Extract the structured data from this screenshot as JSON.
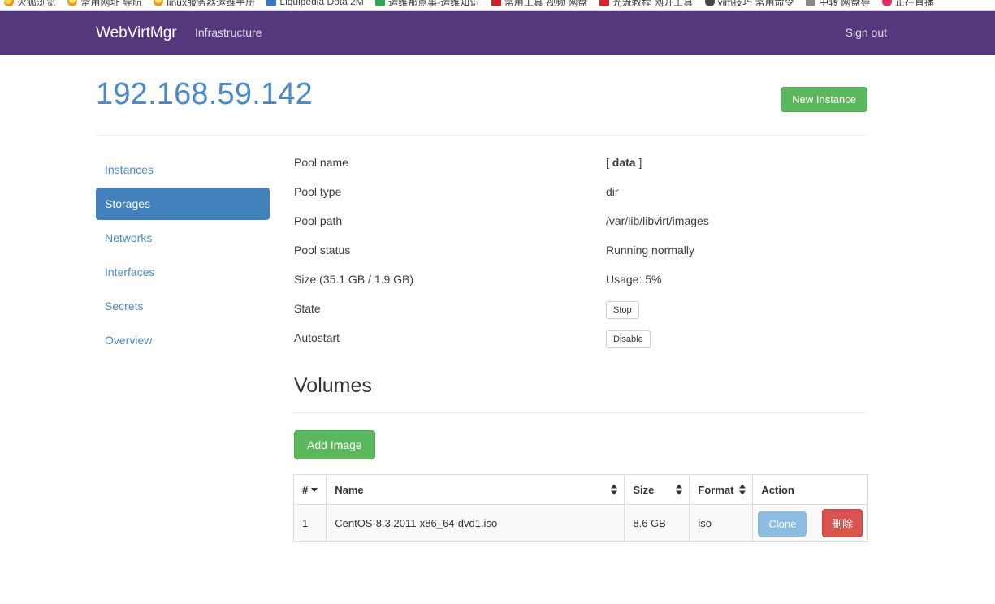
{
  "browser": {
    "bookmarks": [
      {
        "label": "火狐浏览",
        "icon": "firefox-icon"
      },
      {
        "label": "常用网址 导航",
        "icon": "star-icon"
      },
      {
        "label": "linux服务器运维手册",
        "icon": "tux-icon"
      },
      {
        "label": "Liquipedia Dota 2M",
        "icon": "dota-icon"
      },
      {
        "label": "运维那点事-运维知识",
        "icon": "wrench-icon"
      },
      {
        "label": "常用工具 视频 网盘",
        "icon": "circle-icon"
      },
      {
        "label": "光流教程 网开工具",
        "icon": "youtube-icon"
      },
      {
        "label": "vim技巧 常用命令",
        "icon": "gear-icon"
      },
      {
        "label": "中转 网盘导",
        "icon": "disk-icon"
      },
      {
        "label": "正在直播",
        "icon": "live-icon"
      }
    ]
  },
  "navbar": {
    "brand": "WebVirtMgr",
    "infrastructure_link": "Infrastructure",
    "sign_out": "Sign out",
    "background": "#54387c"
  },
  "header": {
    "title": "192.168.59.142",
    "title_color": "#4b89c8",
    "new_instance_button": "New Instance",
    "new_instance_color": "#5cb85c"
  },
  "sidebar": {
    "items": [
      {
        "label": "Instances",
        "active": false
      },
      {
        "label": "Storages",
        "active": true
      },
      {
        "label": "Networks",
        "active": false
      },
      {
        "label": "Interfaces",
        "active": false
      },
      {
        "label": "Secrets",
        "active": false
      },
      {
        "label": "Overview",
        "active": false
      }
    ],
    "active_color": "#4281bb",
    "link_color": "#4b89c8"
  },
  "pool_details": [
    {
      "label": "Pool name",
      "value": "[ data ]",
      "bold_value": true,
      "type": "text"
    },
    {
      "label": "Pool type",
      "value": "dir",
      "bold_value": false,
      "type": "text"
    },
    {
      "label": "Pool path",
      "value": "/var/lib/libvirt/images",
      "bold_value": false,
      "type": "text"
    },
    {
      "label": "Pool status",
      "value": "Running normally",
      "bold_value": false,
      "type": "text"
    },
    {
      "label": "Size (35.1 GB / 1.9 GB)",
      "value": "Usage: 5%",
      "bold_value": false,
      "type": "text"
    },
    {
      "label": "State",
      "value": "Stop",
      "bold_value": false,
      "type": "button"
    },
    {
      "label": "Autostart",
      "value": "Disable",
      "bold_value": false,
      "type": "button"
    }
  ],
  "pool_summary": {
    "name": "data",
    "type": "dir",
    "path": "/var/lib/libvirt/images",
    "status": "Running normally",
    "size_total": "35.1 GB",
    "size_used": "1.9 GB",
    "usage_percent": "5%",
    "state_action": "Stop",
    "autostart_action": "Disable"
  },
  "volumes": {
    "section_title": "Volumes",
    "add_image_button": "Add Image",
    "columns": [
      {
        "label": "#",
        "sort": "desc"
      },
      {
        "label": "Name",
        "sort": "both"
      },
      {
        "label": "Size",
        "sort": "both"
      },
      {
        "label": "Format",
        "sort": "both"
      },
      {
        "label": "Action",
        "sort": "none"
      }
    ],
    "rows": [
      {
        "index": "1",
        "name": "CentOS-8.3.2011-x86_64-dvd1.iso",
        "size": "8.6 GB",
        "format": "iso",
        "clone_label": "Clone",
        "delete_label": "删除"
      }
    ],
    "clone_color": "#8bbde0",
    "delete_color": "#d9534f"
  }
}
